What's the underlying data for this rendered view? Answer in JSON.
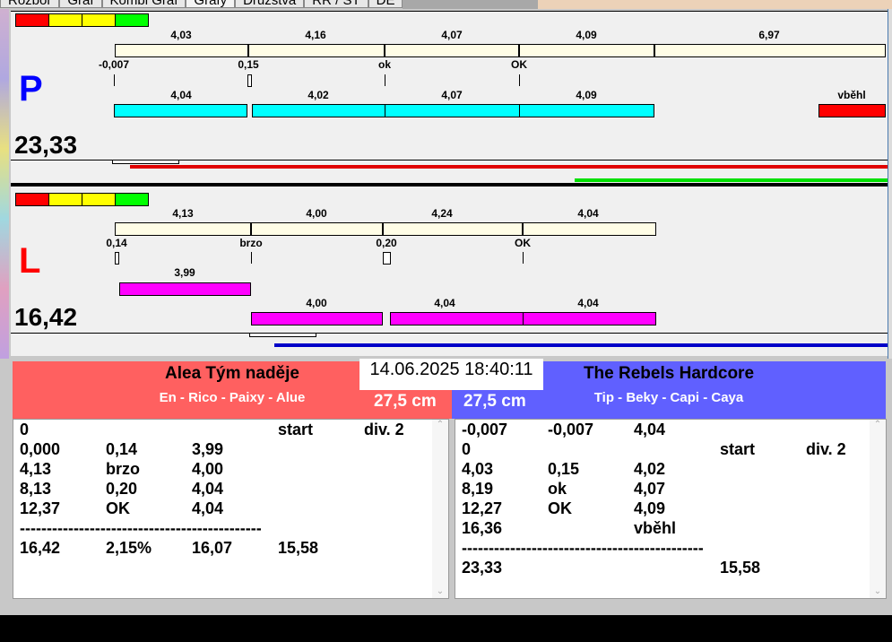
{
  "tabs": [
    "Rozbor",
    "Graf",
    "Kombi Graf",
    "Grafy",
    "Družstva",
    "RR / ST",
    "DE"
  ],
  "colors": {
    "team_p": "#0000ff",
    "team_l": "#ff0000",
    "header_left": "#ff6060",
    "header_right": "#6060ff",
    "cyan": "#00ffff",
    "magenta": "#ff00ff"
  },
  "lane_p": {
    "letter": "P",
    "score": "23,33",
    "top_labels": [
      "4,03",
      "4,16",
      "4,07",
      "4,09",
      "6,97"
    ],
    "sub_labels": [
      "-0,007",
      "0,15",
      "ok",
      "OK"
    ],
    "bar_labels": [
      "4,04",
      "4,02",
      "4,07",
      "4,09",
      "vběhl"
    ]
  },
  "lane_l": {
    "letter": "L",
    "score": "16,42",
    "top_labels": [
      "4,13",
      "4,00",
      "4,24",
      "4,04"
    ],
    "sub_labels": [
      "0,14",
      "brzo",
      "0,20",
      "OK"
    ],
    "first_bar_label": "3,99",
    "bar_labels": [
      "4,00",
      "4,04",
      "4,04"
    ]
  },
  "datetime": "14.06.2025 18:40:11",
  "left_team": {
    "name": "Alea Tým naděje",
    "members": "En - Rico - Paixy - Alue",
    "size": "27,5 cm",
    "rows": [
      [
        "0",
        "",
        "",
        "start",
        "div. 2"
      ],
      [
        "0,000",
        "0,14",
        "3,99",
        "",
        ""
      ],
      [
        "4,13",
        "brzo",
        "4,00",
        "",
        ""
      ],
      [
        "8,13",
        "0,20",
        "4,04",
        "",
        ""
      ],
      [
        "12,37",
        "OK",
        "4,04",
        "",
        ""
      ],
      [
        "---------------------------------------------",
        "",
        "",
        "",
        ""
      ],
      [
        "16,42",
        "2,15%",
        "16,07",
        "15,58",
        ""
      ]
    ]
  },
  "right_team": {
    "name": "The Rebels Hardcore",
    "members": "Tip - Beky - Capi - Caya",
    "size": "27,5 cm",
    "rows": [
      [
        "-0,007",
        "-0,007",
        "4,04",
        "",
        ""
      ],
      [
        "0",
        "",
        "",
        "start",
        "div. 2"
      ],
      [
        "4,03",
        "0,15",
        "4,02",
        "",
        ""
      ],
      [
        "8,19",
        "ok",
        "4,07",
        "",
        ""
      ],
      [
        "12,27",
        "OK",
        "4,09",
        "",
        ""
      ],
      [
        "16,36",
        "",
        "vběhl",
        "",
        ""
      ],
      [
        "---------------------------------------------",
        "",
        "",
        "",
        ""
      ],
      [
        "23,33",
        "",
        "",
        "15,58",
        ""
      ]
    ]
  }
}
